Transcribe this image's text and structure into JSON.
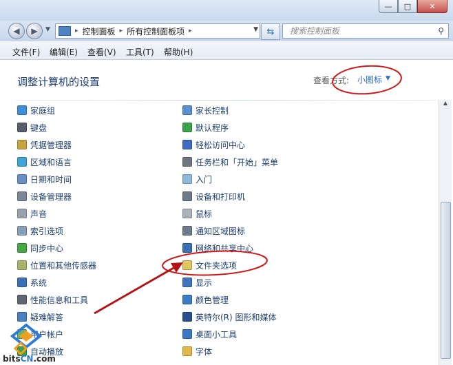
{
  "window": {
    "minimize": "—",
    "maximize": "□",
    "close": "✕"
  },
  "address": {
    "crumbs": [
      "控制面板",
      "所有控制面板项"
    ]
  },
  "search": {
    "placeholder": "搜索控制面板"
  },
  "menu": [
    "文件(F)",
    "编辑(E)",
    "查看(V)",
    "工具(T)",
    "帮助(H)"
  ],
  "header": {
    "title": "调整计算机的设置",
    "view_by_label": "查看方式:",
    "view_by_value": "小图标"
  },
  "items_left": [
    {
      "label": "家庭组",
      "color": "#3d8fd9"
    },
    {
      "label": "键盘",
      "color": "#555f6b"
    },
    {
      "label": "凭据管理器",
      "color": "#c9a341"
    },
    {
      "label": "区域和语言",
      "color": "#3fa3d6"
    },
    {
      "label": "日期和时间",
      "color": "#6a8fc7"
    },
    {
      "label": "设备管理器",
      "color": "#7b8796"
    },
    {
      "label": "声音",
      "color": "#9aa3ad"
    },
    {
      "label": "索引选项",
      "color": "#8aa0b8"
    },
    {
      "label": "同步中心",
      "color": "#45a845"
    },
    {
      "label": "位置和其他传感器",
      "color": "#a8b46a"
    },
    {
      "label": "系统",
      "color": "#3a6fb7"
    },
    {
      "label": "性能信息和工具",
      "color": "#5d6672"
    },
    {
      "label": "疑难解答",
      "color": "#4b7fc4"
    },
    {
      "label": "用户帐户",
      "color": "#6db36d"
    },
    {
      "label": "自动播放",
      "color": "#3fa04a"
    }
  ],
  "items_right": [
    {
      "label": "家长控制",
      "color": "#5b8fd0"
    },
    {
      "label": "默认程序",
      "color": "#3aa34a"
    },
    {
      "label": "轻松访问中心",
      "color": "#3e6cc4"
    },
    {
      "label": "任务栏和「开始」菜单",
      "color": "#6e7680"
    },
    {
      "label": "入门",
      "color": "#8fb9d9"
    },
    {
      "label": "设备和打印机",
      "color": "#6d7a89"
    },
    {
      "label": "鼠标",
      "color": "#aab2bb"
    },
    {
      "label": "通知区域图标",
      "color": "#6f7b88"
    },
    {
      "label": "网络和共享中心",
      "color": "#3c6fb5"
    },
    {
      "label": "文件夹选项",
      "color": "#e2c760"
    },
    {
      "label": "显示",
      "color": "#3f74bf"
    },
    {
      "label": "颜色管理",
      "color": "#3b7ac6"
    },
    {
      "label": "英特尔(R) 图形和媒体",
      "color": "#2a4f8f"
    },
    {
      "label": "桌面小工具",
      "color": "#3a78c5"
    },
    {
      "label": "字体",
      "color": "#e3b84a"
    }
  ],
  "watermark": {
    "text_dark": "bits",
    "text_blue": "CN",
    "text_suffix": ".com"
  },
  "colors": {
    "annotation": "#d01818",
    "link": "#1e3f73",
    "accent": "#2a6bd1"
  }
}
